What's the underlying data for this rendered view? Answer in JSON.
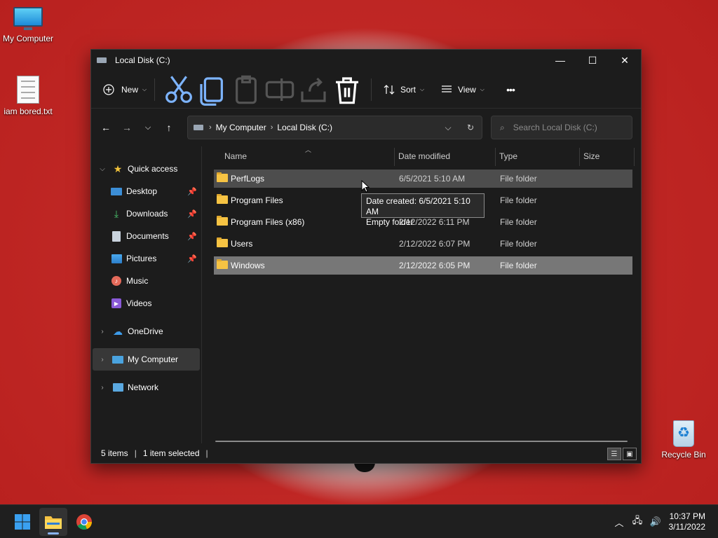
{
  "desktop": {
    "icons": [
      {
        "label": "My Computer"
      },
      {
        "label": "iam bored.txt"
      },
      {
        "label": "Recycle Bin"
      }
    ]
  },
  "window": {
    "title": "Local Disk (C:)",
    "controls": {
      "minimize": "—",
      "maximize": "☐",
      "close": "✕"
    }
  },
  "toolbar": {
    "new_label": "New",
    "sort_label": "Sort",
    "view_label": "View",
    "more_label": "•••"
  },
  "address": {
    "crumbs": [
      "My Computer",
      "Local Disk (C:)"
    ],
    "search_placeholder": "Search Local Disk (C:)"
  },
  "navpane": {
    "quick_access": "Quick access",
    "items": [
      {
        "label": "Desktop"
      },
      {
        "label": "Downloads"
      },
      {
        "label": "Documents"
      },
      {
        "label": "Pictures"
      },
      {
        "label": "Music"
      },
      {
        "label": "Videos"
      }
    ],
    "onedrive": "OneDrive",
    "my_computer": "My Computer",
    "network": "Network"
  },
  "columns": {
    "name": "Name",
    "date": "Date modified",
    "type": "Type",
    "size": "Size"
  },
  "files": [
    {
      "name": "PerfLogs",
      "date": "6/5/2021 5:10 AM",
      "type": "File folder"
    },
    {
      "name": "Program Files",
      "date": "",
      "type": "File folder"
    },
    {
      "name": "Program Files (x86)",
      "date": "2/12/2022 6:11 PM",
      "type": "File folder"
    },
    {
      "name": "Users",
      "date": "2/12/2022 6:07 PM",
      "type": "File folder"
    },
    {
      "name": "Windows",
      "date": "2/12/2022 6:05 PM",
      "type": "File folder"
    }
  ],
  "tooltip": {
    "line1": "Date created: 6/5/2021 5:10 AM",
    "line2": "Empty folder"
  },
  "status": {
    "items": "5 items",
    "selected": "1 item selected"
  },
  "taskbar": {
    "time": "10:37 PM",
    "date": "3/11/2022"
  }
}
